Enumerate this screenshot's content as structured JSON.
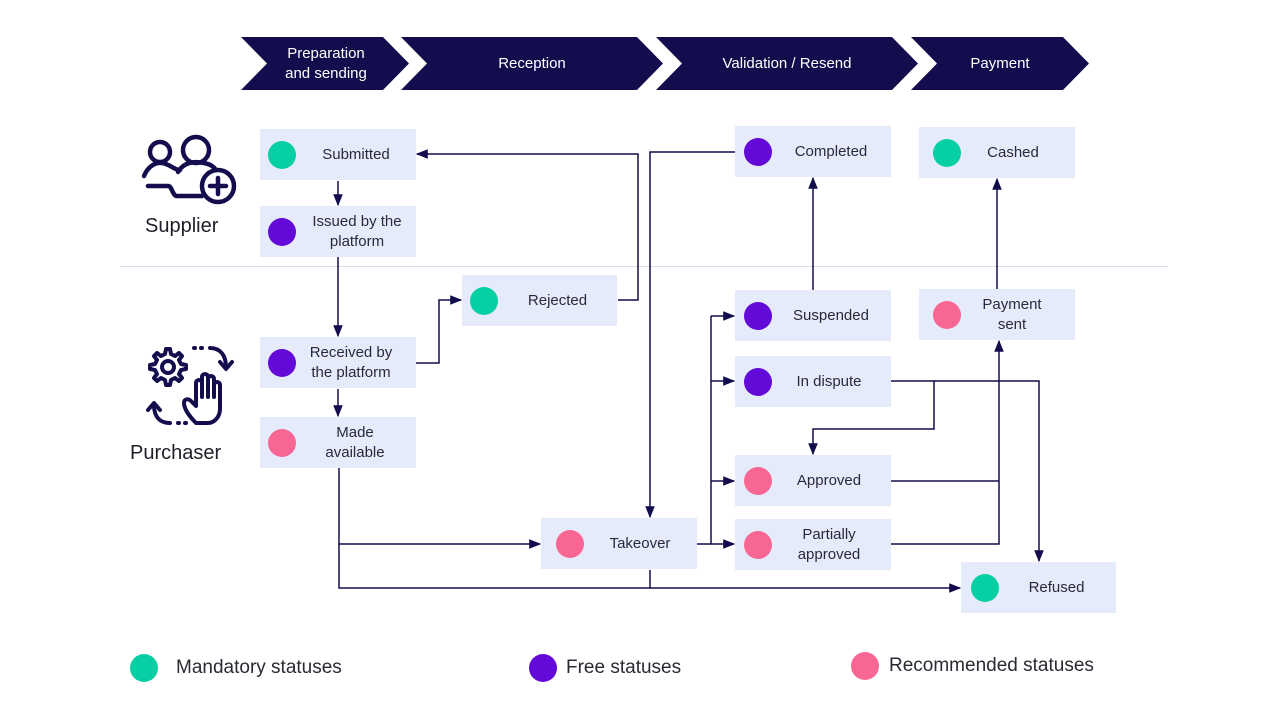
{
  "phases": [
    {
      "line1": "Preparation",
      "line2": "and sending"
    },
    {
      "line1": "Reception"
    },
    {
      "line1": "Validation / Resend"
    },
    {
      "line1": "Payment"
    }
  ],
  "roles": {
    "supplier": "Supplier",
    "purchaser": "Purchaser"
  },
  "colors": {
    "mandatory": "#06cfa3",
    "free": "#6309d8",
    "recommended": "#f86693",
    "phase_bg": "#140d4d",
    "box_bg": "#e6ebfb",
    "line": "#140d4d"
  },
  "statuses": {
    "submitted": {
      "label": "Submitted",
      "type": "mandatory"
    },
    "issued": {
      "label": "Issued by the platform",
      "type": "free"
    },
    "received": {
      "label": "Received by the platform",
      "type": "free"
    },
    "made_available": {
      "label": "Made available",
      "type": "recommended"
    },
    "rejected": {
      "label": "Rejected",
      "type": "mandatory"
    },
    "takeover": {
      "label": "Takeover",
      "type": "recommended"
    },
    "completed": {
      "label": "Completed",
      "type": "free"
    },
    "suspended": {
      "label": "Suspended",
      "type": "free"
    },
    "in_dispute": {
      "label": "In dispute",
      "type": "free"
    },
    "approved": {
      "label": "Approved",
      "type": "recommended"
    },
    "partially_approved": {
      "label": "Partially approved",
      "type": "recommended"
    },
    "cashed": {
      "label": "Cashed",
      "type": "mandatory"
    },
    "payment_sent": {
      "label": "Payment sent",
      "type": "recommended"
    },
    "refused": {
      "label": "Refused",
      "type": "mandatory"
    }
  },
  "transitions": [
    [
      "submitted",
      "issued"
    ],
    [
      "issued",
      "received"
    ],
    [
      "received",
      "made_available"
    ],
    [
      "received",
      "rejected"
    ],
    [
      "rejected",
      "submitted"
    ],
    [
      "completed",
      "takeover"
    ],
    [
      "made_available",
      "takeover"
    ],
    [
      "made_available",
      "refused"
    ],
    [
      "takeover",
      "suspended"
    ],
    [
      "takeover",
      "in_dispute"
    ],
    [
      "takeover",
      "approved"
    ],
    [
      "takeover",
      "partially_approved"
    ],
    [
      "takeover",
      "refused"
    ],
    [
      "suspended",
      "completed"
    ],
    [
      "in_dispute",
      "approved"
    ],
    [
      "in_dispute",
      "refused"
    ],
    [
      "approved",
      "payment_sent"
    ],
    [
      "partially_approved",
      "payment_sent"
    ],
    [
      "payment_sent",
      "cashed"
    ]
  ],
  "legend": [
    {
      "label": "Mandatory statuses",
      "type": "mandatory"
    },
    {
      "label": "Free statuses",
      "type": "free"
    },
    {
      "label": "Recommended statuses",
      "type": "recommended"
    }
  ]
}
